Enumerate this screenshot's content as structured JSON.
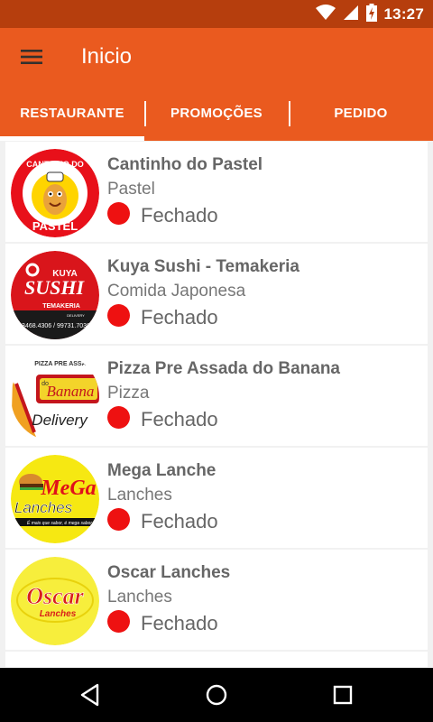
{
  "status_bar": {
    "time": "13:27"
  },
  "toolbar": {
    "title": "Inicio"
  },
  "tabs": [
    {
      "label": "RESTAURANTE",
      "active": true
    },
    {
      "label": "PROMOÇÕES",
      "active": false
    },
    {
      "label": "PEDIDO",
      "active": false
    }
  ],
  "colors": {
    "toolbar": "#ea5a1f",
    "status_bar": "#b63e0d",
    "closed_dot": "#ee1111"
  },
  "restaurants": [
    {
      "name": "Cantinho do Pastel",
      "category": "Pastel",
      "status": "Fechado",
      "logo": {
        "line1": "CANTINHO DO",
        "line2": "PASTEL"
      }
    },
    {
      "name": "Kuya Sushi - Temakeria",
      "category": "Comida Japonesa",
      "status": "Fechado",
      "logo": {
        "line1": "KUYA",
        "line2": "SUSHI",
        "line3": "TEMAKERIA",
        "line4": "DELIVERY",
        "phone": "3468.4306 / 99731.7036"
      }
    },
    {
      "name": "Pizza Pre Assada do Banana",
      "category": "Pizza",
      "status": "Fechado",
      "logo": {
        "line1": "PIZZA PRE ASSADA",
        "line2": "do",
        "line3": "Banana",
        "line4": "Delivery"
      }
    },
    {
      "name": "Mega Lanche",
      "category": "Lanches",
      "status": "Fechado",
      "logo": {
        "line1": "MeGa",
        "line2": "Lanches",
        "line3": "É mais que sabor, é mega sabor"
      }
    },
    {
      "name": "Oscar Lanches",
      "category": "Lanches",
      "status": "Fechado",
      "logo": {
        "line1": "Oscar",
        "line2": "Lanches"
      }
    }
  ]
}
